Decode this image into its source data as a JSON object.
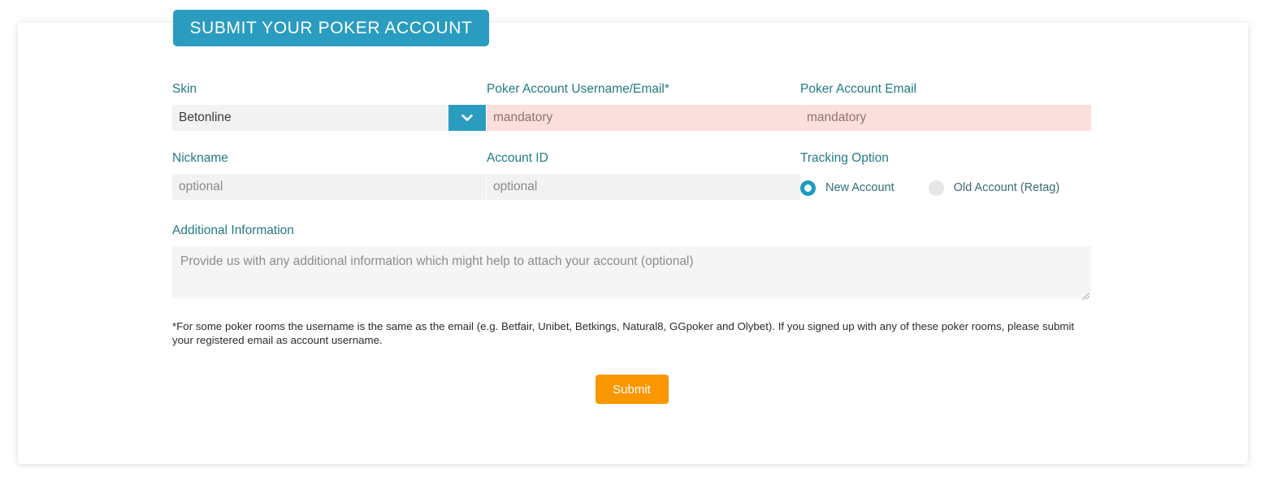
{
  "header": {
    "tab_title": "SUBMIT YOUR POKER ACCOUNT"
  },
  "form": {
    "skin": {
      "label": "Skin",
      "value": "Betonline",
      "arrow_icon": "chevron-down-icon"
    },
    "username": {
      "label": "Poker Account Username/Email*",
      "value": "",
      "placeholder": "mandatory",
      "required": true
    },
    "email": {
      "label": "Poker Account Email",
      "value": "",
      "placeholder": "mandatory",
      "required": true
    },
    "nickname": {
      "label": "Nickname",
      "value": "",
      "placeholder": "optional"
    },
    "account_id": {
      "label": "Account ID",
      "value": "",
      "placeholder": "optional"
    },
    "tracking_option": {
      "label": "Tracking Option",
      "options": [
        {
          "label": "New Account",
          "selected": true
        },
        {
          "label": "Old Account (Retag)",
          "selected": false
        }
      ]
    },
    "additional_information": {
      "label": "Additional Information",
      "value": "",
      "placeholder": "Provide us with any additional information which might help to attach your account (optional)"
    },
    "footnote": "*For some poker rooms the username is the same as the email (e.g. Betfair, Unibet, Betkings, Natural8, GGpoker and Olybet). If you signed up with any of these poker rooms, please submit your registered email as account username.",
    "submit_label": "Submit"
  },
  "colors": {
    "teal": "#2a9cc0",
    "label_teal": "#247a86",
    "orange": "#fa9600",
    "mandatory_bg": "#fbdfdc",
    "input_bg": "#f2f2f2"
  }
}
